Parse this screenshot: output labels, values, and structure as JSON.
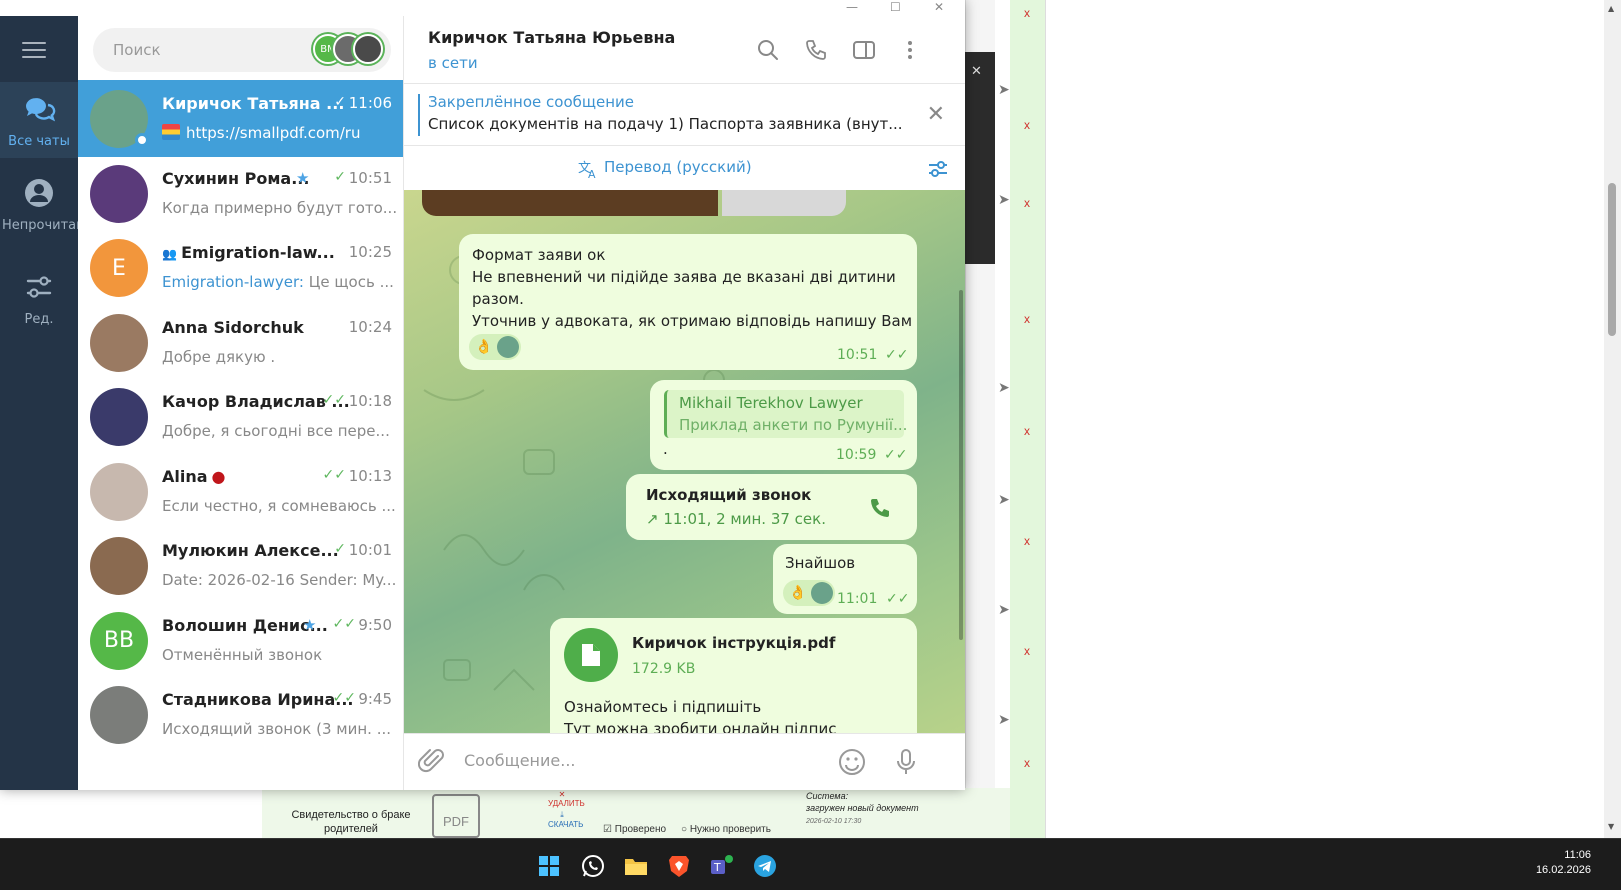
{
  "window": {
    "minimize": "—",
    "maximize": "☐",
    "close": "✕"
  },
  "rail": {
    "items": [
      {
        "label": "Все чаты",
        "icon": "chats-icon"
      },
      {
        "label": "Непрочитано",
        "icon": "person-icon"
      },
      {
        "label": "Ред.",
        "icon": "edit-folders-icon"
      }
    ]
  },
  "search": {
    "placeholder": "Поиск",
    "story_initials": "ВМ"
  },
  "chats": [
    {
      "name": "Киричок Татьяна ...",
      "time": "11:06",
      "check": "✓",
      "preview": "https://smallpdf.com/ru",
      "avatar_color": "#6aa28a",
      "active": true
    },
    {
      "name": "Сухинин Рома...",
      "time": "10:51",
      "check": "✓",
      "preview": "Когда примерно будут гото...",
      "avatar_color": "#5a3a7a",
      "star": true
    },
    {
      "name": "Emigration-law...",
      "time": "10:25",
      "check": "",
      "preview_sender": "Emigration-lawyer:",
      "preview": "Це щось ...",
      "avatar_color": "#f2963c",
      "initials": "E",
      "group": true
    },
    {
      "name": "Anna Sidorchuk",
      "time": "10:24",
      "check": "",
      "preview": "Добре дякую .",
      "avatar_color": "#9a7a62"
    },
    {
      "name": "Качор Владислав ...",
      "time": "10:18",
      "check": "✓✓",
      "preview": "Добре, я сьогодні все пере...",
      "avatar_color": "#3a3a6a"
    },
    {
      "name": "Alina",
      "time": "10:13",
      "check": "✓✓",
      "preview": "Если честно, я сомневаюсь ...",
      "avatar_color": "#c7b8ae",
      "badge": "●"
    },
    {
      "name": "Мулюкин Алексе...",
      "time": "10:01",
      "check": "✓",
      "preview": "Date: 2026-02-16 Sender: My...",
      "avatar_color": "#8a6a50"
    },
    {
      "name": "Волошин Денис...",
      "time": "9:50",
      "check": "✓✓",
      "preview": "Отменённый звонок",
      "avatar_color": "#55b848",
      "initials": "ВВ",
      "star": true
    },
    {
      "name": "Стадникова Ирина...",
      "time": "9:45",
      "check": "✓✓",
      "preview": "Исходящий звонок (3 мин. ...",
      "avatar_color": "#7b7d7a"
    }
  ],
  "header": {
    "name": "Киричок Татьяна Юрьевна",
    "status": "в сети"
  },
  "pinned": {
    "title": "Закреплённое сообщение",
    "text": "Список документів на подачу  1) Паспорта заявника (внут..."
  },
  "translate": {
    "label": "Перевод (русский)"
  },
  "messages": {
    "m1": {
      "lines": [
        "Формат заяви ок",
        "Не впевнений чи підійде заява де вказані дві дитини",
        "разом.",
        "Уточнив у адвоката, як отримаю відповідь напишу Вам"
      ],
      "time": "10:51",
      "tick": "✓✓",
      "reaction": "👌"
    },
    "m2": {
      "reply_name": "Mikhail Terekhov Lawyer",
      "reply_text": "Приклад анкети по Румунії...",
      "text": ".",
      "time": "10:59",
      "tick": "✓✓"
    },
    "m3": {
      "title": "Исходящий звонок",
      "detail": "11:01, 2 мин. 37 сек."
    },
    "m4": {
      "text": "Знайшов",
      "time": "11:01",
      "tick": "✓✓",
      "reaction": "👌"
    },
    "m5": {
      "file_name": "Киричок інструкція.pdf",
      "file_size": "172.9 KB",
      "text": "Ознайомтесь і підпишіть",
      "text2": "Тут можна зробити онлайн підпис"
    }
  },
  "composer": {
    "placeholder": "Сообщение..."
  },
  "background_page": {
    "marks": [
      "x",
      "x",
      "x",
      "x",
      "x",
      "x",
      "x",
      "x"
    ],
    "doc_title": "Свидетельство о браке родителей",
    "pdf": "PDF",
    "delete": "УДАЛИТЬ",
    "download": "СКАЧАТЬ",
    "checked": "Проверено",
    "need_check": "Нужно проверить",
    "system_title": "Система:",
    "system_text": "загружен новый документ",
    "system_date": "2026-02-10 17:30"
  },
  "taskbar": {
    "time": "11:06",
    "date": "16.02.2026"
  }
}
